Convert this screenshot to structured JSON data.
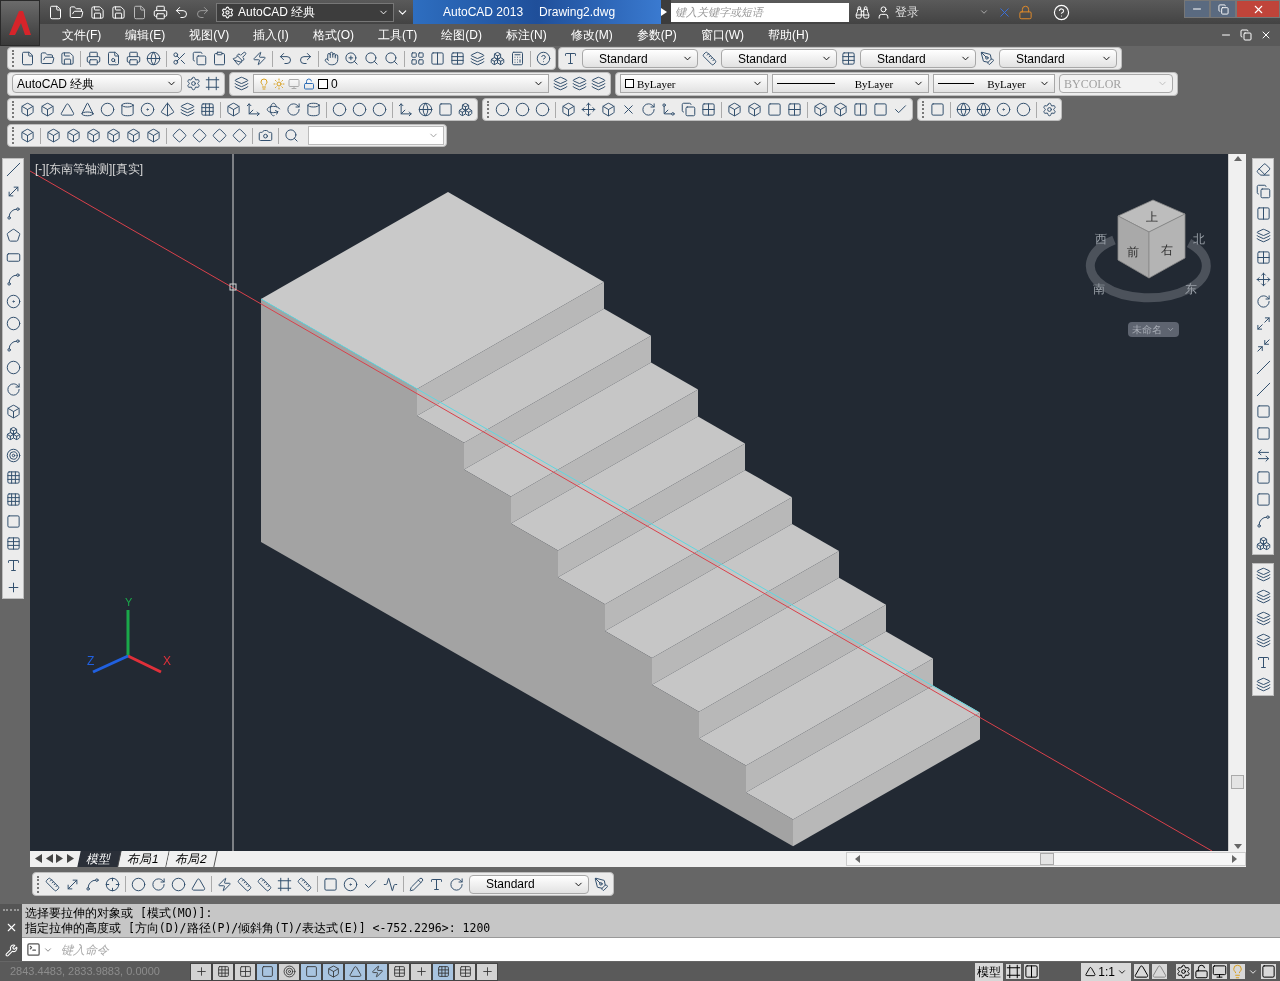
{
  "title_bar": {
    "workspace": "AutoCAD 经典",
    "app_name": "AutoCAD 2013",
    "file_name": "Drawing2.dwg",
    "search": {
      "placeholder": "键入关键字或短语"
    },
    "sign_in": "登录"
  },
  "menu": [
    "文件(F)",
    "编辑(E)",
    "视图(V)",
    "插入(I)",
    "格式(O)",
    "工具(T)",
    "绘图(D)",
    "标注(N)",
    "修改(M)",
    "参数(P)",
    "窗口(W)",
    "帮助(H)"
  ],
  "style_toolbar": [
    "Standard",
    "Standard",
    "Standard",
    "Standard"
  ],
  "workspace_toolbar": {
    "workspace": "AutoCAD 经典"
  },
  "layer_toolbar": {
    "layer": "0"
  },
  "properties_toolbar": {
    "color_control": "ByLayer",
    "linetype": "ByLayer",
    "lineweight": "ByLayer",
    "plot_style": {
      "value": "BYCOLOR",
      "disabled": true
    }
  },
  "viewport": {
    "label": "[-][东南等轴测][真实]",
    "viewcube": {
      "faces": [
        "上",
        "前",
        "右"
      ],
      "compass": [
        "西",
        "北",
        "南",
        "东"
      ],
      "ucs_menu": "未命名"
    },
    "ucs_axes": [
      "X",
      "Y",
      "Z"
    ]
  },
  "layout_tabs": [
    {
      "label": "模型",
      "selected": true
    },
    {
      "label": "布局1",
      "selected": false
    },
    {
      "label": "布局2",
      "selected": false
    }
  ],
  "dimension_toolbar": {
    "style": "Standard"
  },
  "command_history": [
    "选择要拉伸的对象或 [模式(MO)]:",
    "指定拉伸的高度或 [方向(D)/路径(P)/倾斜角(T)/表达式(E)] <-752.2296>: 1200"
  ],
  "command_line": {
    "placeholder": "键入命令"
  },
  "status_bar": {
    "coordinates": "2843.4483, 2833.9883, 0.0000",
    "toggles": [
      {
        "on": false
      },
      {
        "on": false
      },
      {
        "on": false
      },
      {
        "on": true
      },
      {
        "on": false
      },
      {
        "on": true
      },
      {
        "on": true
      },
      {
        "on": true
      },
      {
        "on": true
      },
      {
        "on": false
      },
      {
        "on": false
      },
      {
        "on": true
      },
      {
        "on": false
      },
      {
        "on": false
      }
    ],
    "space": "模型",
    "annotation_scale": "1:1"
  }
}
